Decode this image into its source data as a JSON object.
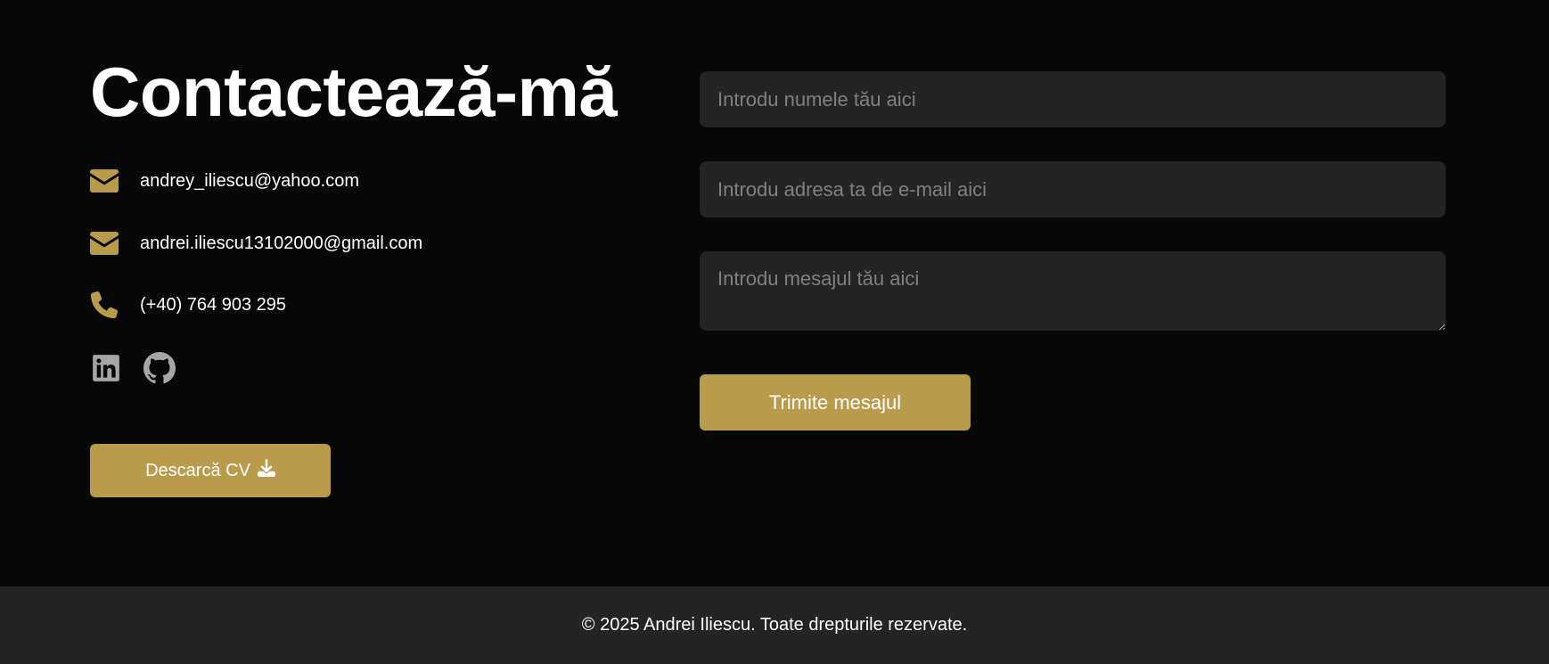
{
  "contact": {
    "title": "Contactează-mă",
    "email_1": "andrey_iliescu@yahoo.com",
    "email_2": "andrei.iliescu13102000@gmail.com",
    "phone": "(+40) 764 903 295",
    "cv_label": "Descarcă CV"
  },
  "socials": {
    "linkedin_icon": "linkedin-icon",
    "github_icon": "github-icon"
  },
  "form": {
    "name_placeholder": "Introdu numele tău aici",
    "email_placeholder": "Introdu adresa ta de e-mail aici",
    "message_placeholder": "Introdu mesajul tău aici",
    "submit_label": "Trimite mesajul"
  },
  "footer": {
    "text": "© 2025 Andrei Iliescu. Toate drepturile rezervate."
  },
  "colors": {
    "background": "#080808",
    "accent": "#b99c4b",
    "field_bg": "#242424",
    "footer_bg": "#242424",
    "social_icon": "#a6a6a6"
  }
}
